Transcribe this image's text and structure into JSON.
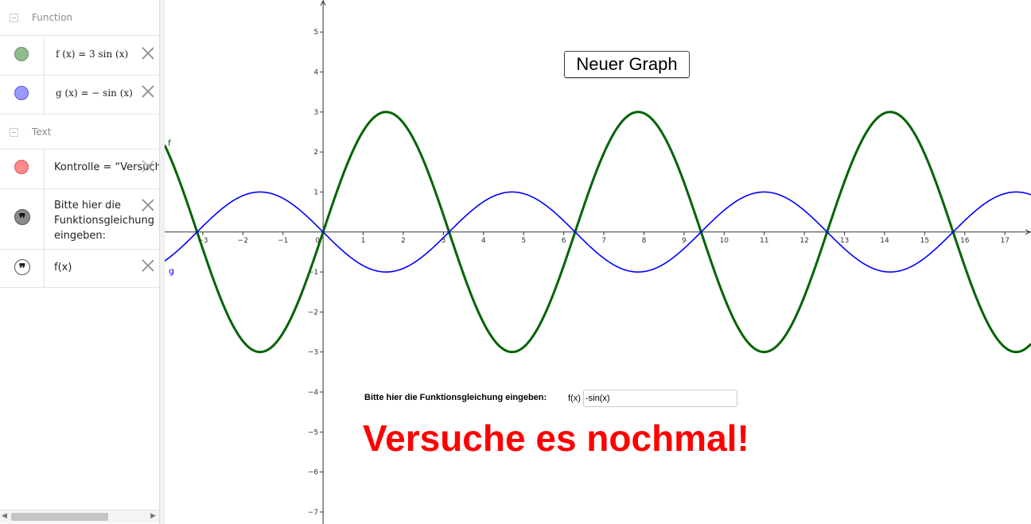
{
  "algebra_view": {
    "sections": [
      {
        "title": "Function",
        "items": [
          {
            "label": "f (x)  =  3  sin (x)",
            "color": "#6aa84f"
          },
          {
            "label": "g (x)  =  − sin (x)",
            "color": "#6666ff"
          }
        ]
      },
      {
        "title": "Text",
        "items": [
          {
            "label": "Kontrolle = “Versuche",
            "color": "#ff6666"
          },
          {
            "label_lines": [
              "Bitte hier die",
              "Funktionsgleichung",
              "eingeben:"
            ],
            "icon": "quote-icon"
          },
          {
            "label": "f(x)",
            "icon": "quote-icon"
          }
        ]
      }
    ]
  },
  "graphics_view": {
    "button_label": "Neuer Graph",
    "prompt_label": "Bitte hier die Funktionsgleichung eingeben:",
    "input_label": "f(x)",
    "input_value": "-sin(x)",
    "feedback_text": "Versuche es nochmal!",
    "feedback_color": "#ff0000",
    "curve_labels": {
      "f": "f",
      "g": "g"
    }
  },
  "chart_data": {
    "type": "line",
    "xlim": [
      -3.95,
      17.65
    ],
    "ylim": [
      -7.3,
      5.8
    ],
    "x_ticks": [
      -3,
      -2,
      -1,
      0,
      1,
      2,
      3,
      4,
      5,
      6,
      7,
      8,
      9,
      10,
      11,
      12,
      13,
      14,
      15,
      16,
      17
    ],
    "y_ticks": [
      -7,
      -6,
      -5,
      -4,
      -3,
      -2,
      -1,
      1,
      2,
      3,
      4,
      5
    ],
    "grid": false,
    "series": [
      {
        "name": "f",
        "expression": "3 sin(x)",
        "amplitude": 3,
        "color": "#006400"
      },
      {
        "name": "g",
        "expression": "-sin(x)",
        "amplitude": -1,
        "color": "#0000ff"
      }
    ]
  }
}
